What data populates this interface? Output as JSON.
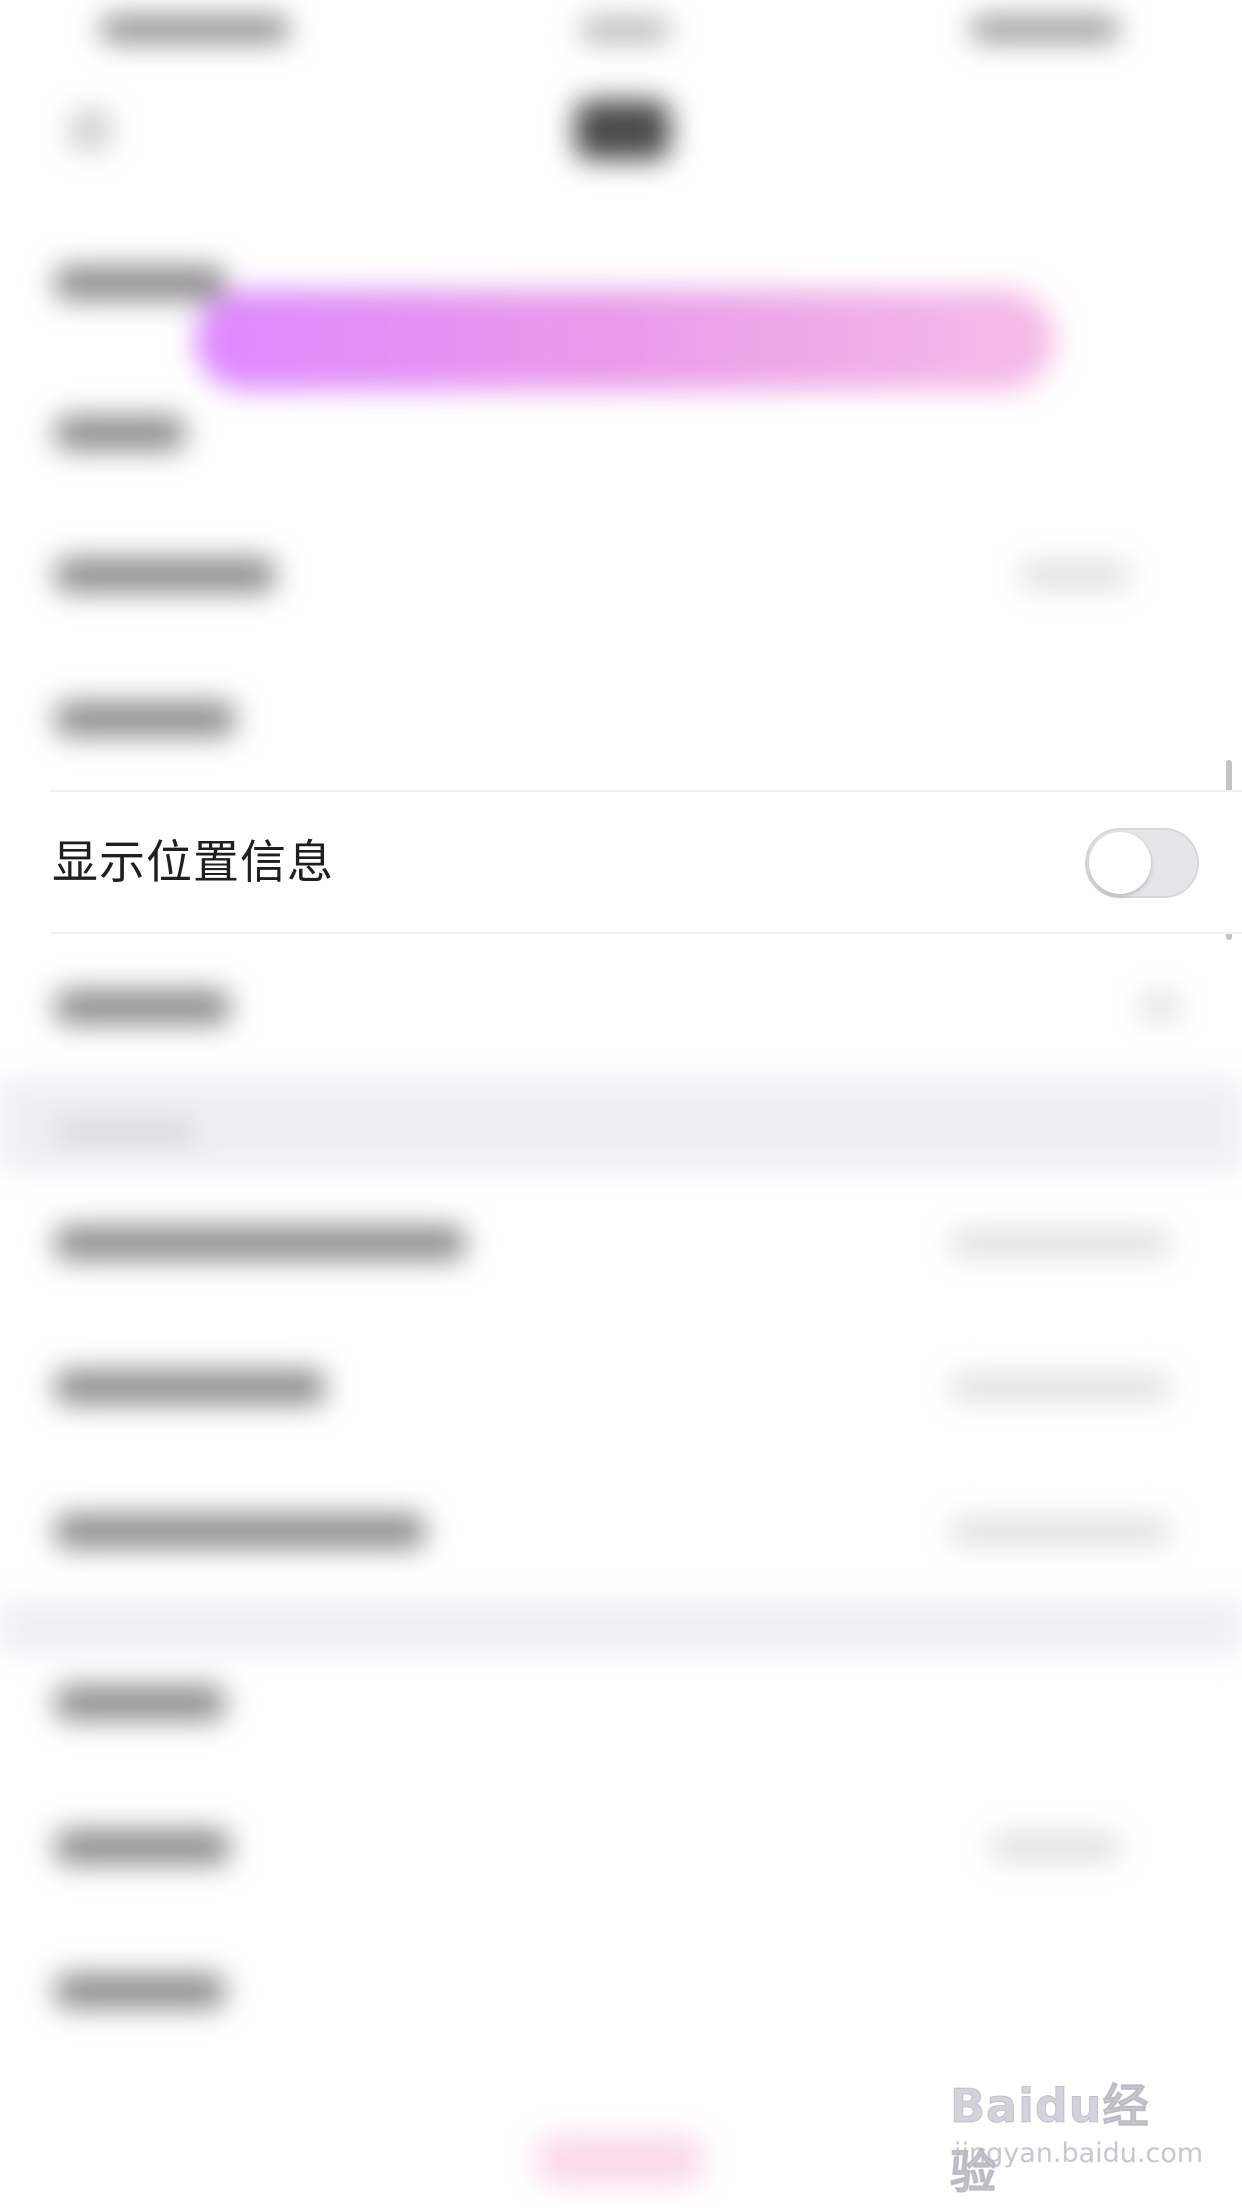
{
  "settings": {
    "location_row": {
      "label": "显示位置信息",
      "toggle_on": false
    }
  },
  "watermark": {
    "brand": "Baidu经验",
    "url": "jingyan.baidu.com"
  },
  "colors": {
    "banner_gradient_start": "#dd88ff",
    "banner_gradient_end": "#f5bde8",
    "toggle_off_track": "#e6e6e9",
    "label_text": "#1f1f1f"
  }
}
